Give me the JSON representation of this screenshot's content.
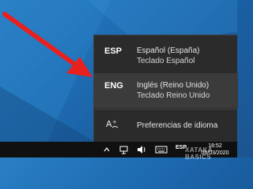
{
  "language_flyout": {
    "items": [
      {
        "code": "ESP",
        "name": "Español (España)",
        "keyboard": "Teclado Español",
        "selected": false
      },
      {
        "code": "ENG",
        "name": "Inglés (Reino Unido)",
        "keyboard": "Teclado Reino Unido",
        "selected": true
      }
    ],
    "preferences_label": "Preferencias de idioma"
  },
  "taskbar": {
    "language_indicator": "ESP",
    "time": "18:52",
    "date": "06/03/2020"
  },
  "watermark": "XATAKA BASICS",
  "colors": {
    "flyout_bg": "#2b2b2b",
    "selected_bg": "#3b3b3b",
    "arrow": "#e8201e",
    "taskbar_bg": "#101010"
  },
  "icons": {
    "chevron": "chevron-up-icon",
    "network": "network-icon",
    "volume": "volume-icon",
    "keyboard": "keyboard-icon",
    "language_settings": "language-settings-icon"
  }
}
